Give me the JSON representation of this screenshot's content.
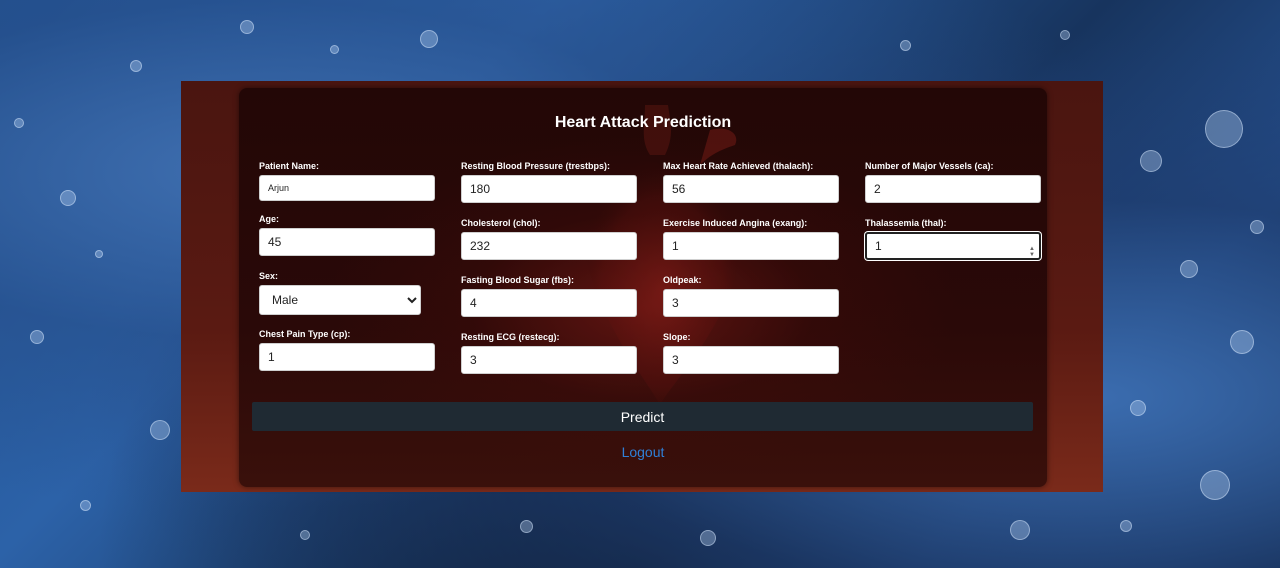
{
  "form": {
    "title": "Heart Attack Prediction",
    "fields": {
      "patient_name": {
        "label": "Patient Name:",
        "value": "Arjun"
      },
      "age": {
        "label": "Age:",
        "value": "45"
      },
      "sex": {
        "label": "Sex:",
        "value": "Male"
      },
      "cp": {
        "label": "Chest Pain Type (cp):",
        "value": "1"
      },
      "trestbps": {
        "label": "Resting Blood Pressure (trestbps):",
        "value": "180"
      },
      "chol": {
        "label": "Cholesterol (chol):",
        "value": "232"
      },
      "fbs": {
        "label": "Fasting Blood Sugar (fbs):",
        "value": "4"
      },
      "restecg": {
        "label": "Resting ECG (restecg):",
        "value": "3"
      },
      "thalach": {
        "label": "Max Heart Rate Achieved (thalach):",
        "value": "56"
      },
      "exang": {
        "label": "Exercise Induced Angina (exang):",
        "value": "1"
      },
      "oldpeak": {
        "label": "Oldpeak:",
        "value": "3"
      },
      "slope": {
        "label": "Slope:",
        "value": "3"
      },
      "ca": {
        "label": "Number of Major Vessels (ca):",
        "value": "2"
      },
      "thal": {
        "label": "Thalassemia (thal):",
        "value": "1"
      }
    },
    "predict_label": "Predict",
    "logout_label": "Logout"
  },
  "colors": {
    "accent_link": "#2f7fd6",
    "button_bg": "#1f2a33",
    "panel_bg": "#4a1510"
  },
  "icons": {
    "spinner": "number-spinner-icon",
    "select": "chevron-down-icon",
    "background": "heart-image"
  }
}
